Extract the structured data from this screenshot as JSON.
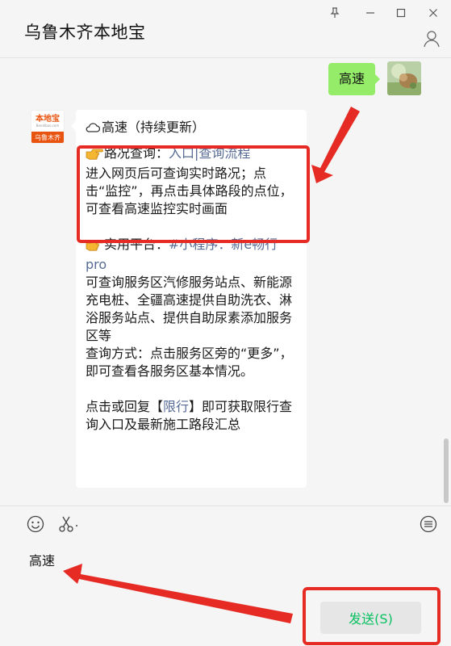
{
  "window": {
    "title": "乌鲁木齐本地宝",
    "controls": [
      "pin-icon",
      "minimize-icon",
      "maximize-icon",
      "close-icon"
    ]
  },
  "chat": {
    "outgoing": {
      "text": "高速"
    },
    "bot_avatar": {
      "logo": "本地宝",
      "domain": "Bendibao.com",
      "city": "乌鲁木齐"
    },
    "reply": {
      "header": "高速（持续更新）",
      "road": {
        "prefix": "路况查询：",
        "link1": "入口",
        "sep": "|",
        "link2": "查询流程",
        "desc": "进入网页后可查询实时路况；点击“监控”，再点击具体路段的点位，可查看高速监控实时画面"
      },
      "platform": {
        "prefix": "实用平台：",
        "link": "#小程序：新e畅行pro",
        "desc": "可查询服务区汽修服务站点、新能源充电桩、全疆高速提供自助洗衣、淋浴服务站点、提供自助尿素添加服务区等",
        "method": "查询方式：点击服务区旁的“更多”，即可查看各服务区基本情况。"
      },
      "footer": {
        "pre": "点击或回复【",
        "link": "限行",
        "post": "】即可获取限行查询入口及最新施工路段汇总"
      }
    }
  },
  "input": {
    "value": "高速",
    "send_label": "发送(S)"
  },
  "colors": {
    "accent_green": "#07c160",
    "bubble_green": "#95ec69",
    "link": "#576b95",
    "annotation_red": "#e52b24"
  }
}
